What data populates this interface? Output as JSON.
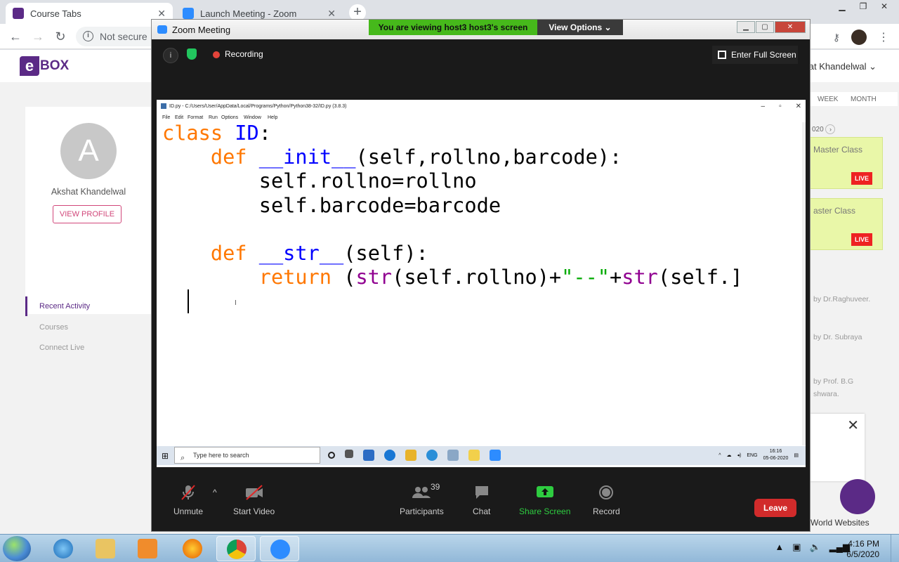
{
  "browser": {
    "tabs": [
      {
        "title": "Course Tabs",
        "active": true
      },
      {
        "title": "Launch Meeting - Zoom",
        "active": false
      }
    ],
    "address": "Not secure"
  },
  "site": {
    "logo": "BOX",
    "logo_mark": "e",
    "user_menu": "hat Khandelwal",
    "profile": {
      "initial": "A",
      "name": "Akshat Khandelwal",
      "view_profile": "VIEW PROFILE"
    },
    "menu": [
      "Recent Activity",
      "Courses",
      "Connect Live"
    ],
    "calendar_tabs": [
      "WEEK",
      "MONTH"
    ],
    "date_fragment": "020",
    "classes": [
      {
        "title": "Master Class",
        "badge": "LIVE"
      },
      {
        "title": "aster Class",
        "badge": "LIVE"
      }
    ],
    "by_lines": [
      "by Dr.Raghuveer.",
      "by Dr. Subraya",
      "by Prof. B.G",
      "shwara."
    ],
    "bottom_text": "World Websites"
  },
  "zoom": {
    "window_title": "Zoom Meeting",
    "viewing_banner": "You are viewing host3 host3's screen",
    "view_options": "View Options",
    "recording_label": "Recording",
    "enter_full_screen": "Enter Full Screen",
    "toolbar": {
      "unmute": "Unmute",
      "start_video": "Start Video",
      "participants": "Participants",
      "participants_count": "39",
      "chat": "Chat",
      "share_screen": "Share Screen",
      "record": "Record",
      "leave": "Leave"
    }
  },
  "shared_screen": {
    "idle_title": "ID.py - C:/Users/User/AppData/Local/Programs/Python/Python38-32/ID.py (3.8.3)",
    "idle_menu": [
      "File",
      "Edit",
      "Format",
      "Run",
      "Options",
      "Window",
      "Help"
    ],
    "code": {
      "class_kw": "class",
      "class_name": "ID",
      "def_kw": "def",
      "init_name": "__init__",
      "init_params": "(self,rollno,barcode):",
      "line3": "self.rollno=rollno",
      "line4": "self.barcode=barcode",
      "str_name": "__str__",
      "str_params": "(self):",
      "return_kw": "return",
      "str_fn": "str",
      "ret_mid": "(self.rollno)+",
      "ret_string": "\"--\"",
      "ret_tail": "(self.]"
    },
    "win10": {
      "search_placeholder": "Type here to search",
      "lang": "ENG",
      "time": "16:16",
      "date": "05-06-2020"
    }
  },
  "taskbar": {
    "time": "4:16 PM",
    "date": "6/5/2020"
  }
}
